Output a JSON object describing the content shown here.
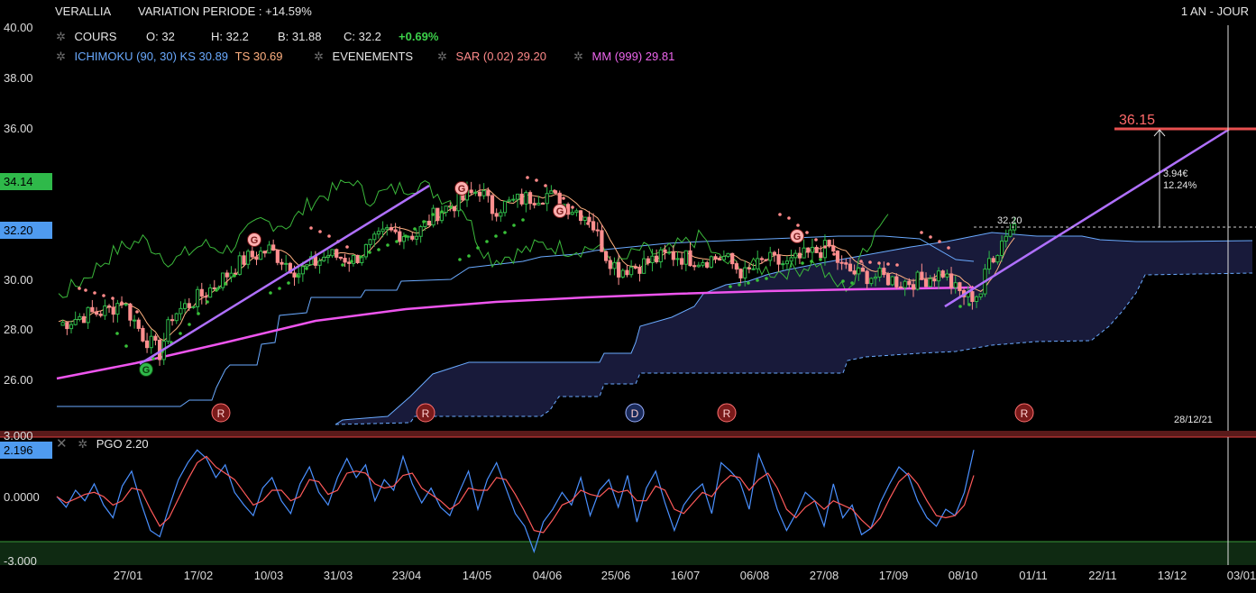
{
  "header": {
    "ticker": "VERALLIA",
    "variation": "VARIATION PERIODE : +14.59%",
    "period": "1 AN - JOUR"
  },
  "legend": {
    "cours_label": "COURS",
    "open": "O: 32",
    "high": "H: 32.2",
    "low": "B: 31.88",
    "close": "C: 32.2",
    "change": "+0.69%",
    "ichimoku": "ICHIMOKU (90, 30) KS 30.89",
    "ts": "TS 30.69",
    "events": "EVENEMENTS",
    "sar": "SAR (0.02) 29.20",
    "mm": "MM (999) 29.81",
    "pgo": "PGO 2.20"
  },
  "icons": {
    "gear": "gear-icon",
    "close": "close-icon"
  },
  "colors": {
    "candle_up": "#2fb94a",
    "candle_down": "#ff8f8f",
    "kijun": "#ffb080",
    "tenkan_cloud_line": "#6aaaff",
    "cloud_fill": "#181a3a",
    "chikou": "#3bb83b",
    "sar": "#ff8a8a",
    "sar_below": "#38c038",
    "mm": "#ee55ee",
    "trend": "#b070ff",
    "target": "#e85050",
    "pgo_fast": "#4a90ff",
    "pgo_slow": "#ff5a5a"
  },
  "chart_data": {
    "type": "candlestick",
    "y_axis": {
      "min": 24.0,
      "max": 40.0,
      "ticks": [
        "40.00",
        "38.00",
        "36.00",
        "30.00",
        "28.00",
        "26.00"
      ]
    },
    "x_ticks": [
      "27/01",
      "17/02",
      "10/03",
      "31/03",
      "23/04",
      "14/05",
      "04/06",
      "25/06",
      "16/07",
      "06/08",
      "27/08",
      "17/09",
      "08/10",
      "01/11",
      "22/11",
      "13/12",
      "03/01"
    ],
    "badges": {
      "price_34": "34.14",
      "last_price": "32.20"
    },
    "last_price_line": "32.20",
    "target": {
      "value": "36.15",
      "gain_abs": "3.94€",
      "gain_pct": "12.24%"
    },
    "cursor_date": "28/12/21",
    "events": [
      "R",
      "R",
      "D",
      "R",
      "R"
    ],
    "event_g": [
      "G",
      "G",
      "G",
      "G",
      "G"
    ],
    "anchors": [
      [
        0,
        28.2
      ],
      [
        6,
        28.6
      ],
      [
        12,
        28.8
      ],
      [
        15,
        29.2
      ],
      [
        20,
        27.8
      ],
      [
        24,
        27.1
      ],
      [
        27,
        28.6
      ],
      [
        35,
        29.5
      ],
      [
        44,
        30.8
      ],
      [
        50,
        31.2
      ],
      [
        57,
        30.3
      ],
      [
        64,
        31.0
      ],
      [
        70,
        30.8
      ],
      [
        78,
        31.9
      ],
      [
        85,
        31.8
      ],
      [
        90,
        32.7
      ],
      [
        96,
        33.2
      ],
      [
        100,
        33.6
      ],
      [
        103,
        32.8
      ],
      [
        110,
        33.2
      ],
      [
        116,
        33.4
      ],
      [
        120,
        33.0
      ],
      [
        126,
        32.5
      ],
      [
        130,
        31.0
      ],
      [
        133,
        30.4
      ],
      [
        138,
        30.6
      ],
      [
        145,
        31.0
      ],
      [
        152,
        30.8
      ],
      [
        158,
        30.9
      ],
      [
        163,
        30.2
      ],
      [
        168,
        30.8
      ],
      [
        173,
        30.6
      ],
      [
        178,
        31.0
      ],
      [
        183,
        31.3
      ],
      [
        186,
        30.5
      ],
      [
        190,
        30.2
      ],
      [
        196,
        30.1
      ],
      [
        200,
        29.9
      ],
      [
        205,
        30.0
      ],
      [
        210,
        30.3
      ],
      [
        213,
        29.6
      ],
      [
        216,
        29.3
      ],
      [
        219,
        29.5
      ],
      [
        221,
        30.8
      ],
      [
        223,
        31.2
      ],
      [
        225,
        31.9
      ],
      [
        227,
        32.2
      ]
    ],
    "pgo": {
      "range": [
        -3.0,
        3.0
      ],
      "ticks": [
        "3.000",
        "0.0000",
        "-3.000"
      ],
      "last": "2.196",
      "fast": [
        0,
        -0.5,
        0.3,
        -0.2,
        0.6,
        -0.4,
        -1.0,
        0.5,
        1.2,
        -0.3,
        -1.6,
        -1.9,
        -0.5,
        0.8,
        1.6,
        2.2,
        1.8,
        0.9,
        1.5,
        0.2,
        -0.4,
        -0.9,
        0.4,
        0.9,
        -0.2,
        -0.8,
        0.6,
        1.4,
        0.2,
        -0.4,
        0.9,
        1.8,
        0.9,
        1.5,
        -0.2,
        0.8,
        0.3,
        1.9,
        0.6,
        -0.3,
        0.4,
        -0.5,
        -0.9,
        0.2,
        1.2,
        -0.6,
        0.8,
        1.6,
        0.4,
        -0.8,
        -1.4,
        -2.6,
        -1.2,
        -0.6,
        0.2,
        -0.4,
        0.9,
        -0.9,
        0.3,
        0.8,
        -0.5,
        1.0,
        -1.2,
        0.4,
        1.2,
        -0.3,
        -1.6,
        -0.4,
        0.2,
        0.6,
        -0.8,
        1.6,
        1.2,
        0.7,
        -0.6,
        2.0,
        0.9,
        -0.6,
        -1.6,
        -0.8,
        0.2,
        -0.2,
        -1.4,
        0.6,
        -1.0,
        -0.4,
        -1.8,
        -1.5,
        -0.3,
        0.6,
        1.4,
        1.0,
        -0.2,
        -1.0,
        -1.4,
        -0.6,
        -0.9,
        0.2,
        2.2
      ],
      "slow": [
        0,
        -0.3,
        -0.1,
        0.1,
        0.2,
        0.0,
        -0.4,
        -0.2,
        0.4,
        0.3,
        -0.6,
        -1.4,
        -1.0,
        -0.1,
        0.8,
        1.6,
        1.9,
        1.4,
        1.1,
        0.8,
        0.2,
        -0.4,
        -0.2,
        0.3,
        0.3,
        -0.2,
        0.0,
        0.8,
        0.7,
        0.1,
        0.3,
        1.1,
        1.2,
        1.1,
        0.6,
        0.4,
        0.5,
        1.0,
        1.1,
        0.4,
        0.1,
        -0.2,
        -0.6,
        -0.3,
        0.4,
        0.3,
        0.3,
        0.9,
        0.8,
        0.1,
        -0.7,
        -1.6,
        -1.7,
        -1.1,
        -0.4,
        -0.2,
        0.3,
        0.1,
        0.0,
        0.4,
        0.2,
        0.3,
        -0.2,
        -0.2,
        0.5,
        0.3,
        -0.6,
        -0.8,
        -0.3,
        0.2,
        0.0,
        0.6,
        1.0,
        0.9,
        0.3,
        0.8,
        1.1,
        0.4,
        -0.6,
        -1.0,
        -0.5,
        -0.2,
        -0.6,
        -0.2,
        -0.4,
        -0.6,
        -1.1,
        -1.5,
        -1.0,
        -0.1,
        0.7,
        1.1,
        0.6,
        -0.2,
        -0.9,
        -1.0,
        -0.9,
        -0.4,
        1.0
      ]
    }
  }
}
